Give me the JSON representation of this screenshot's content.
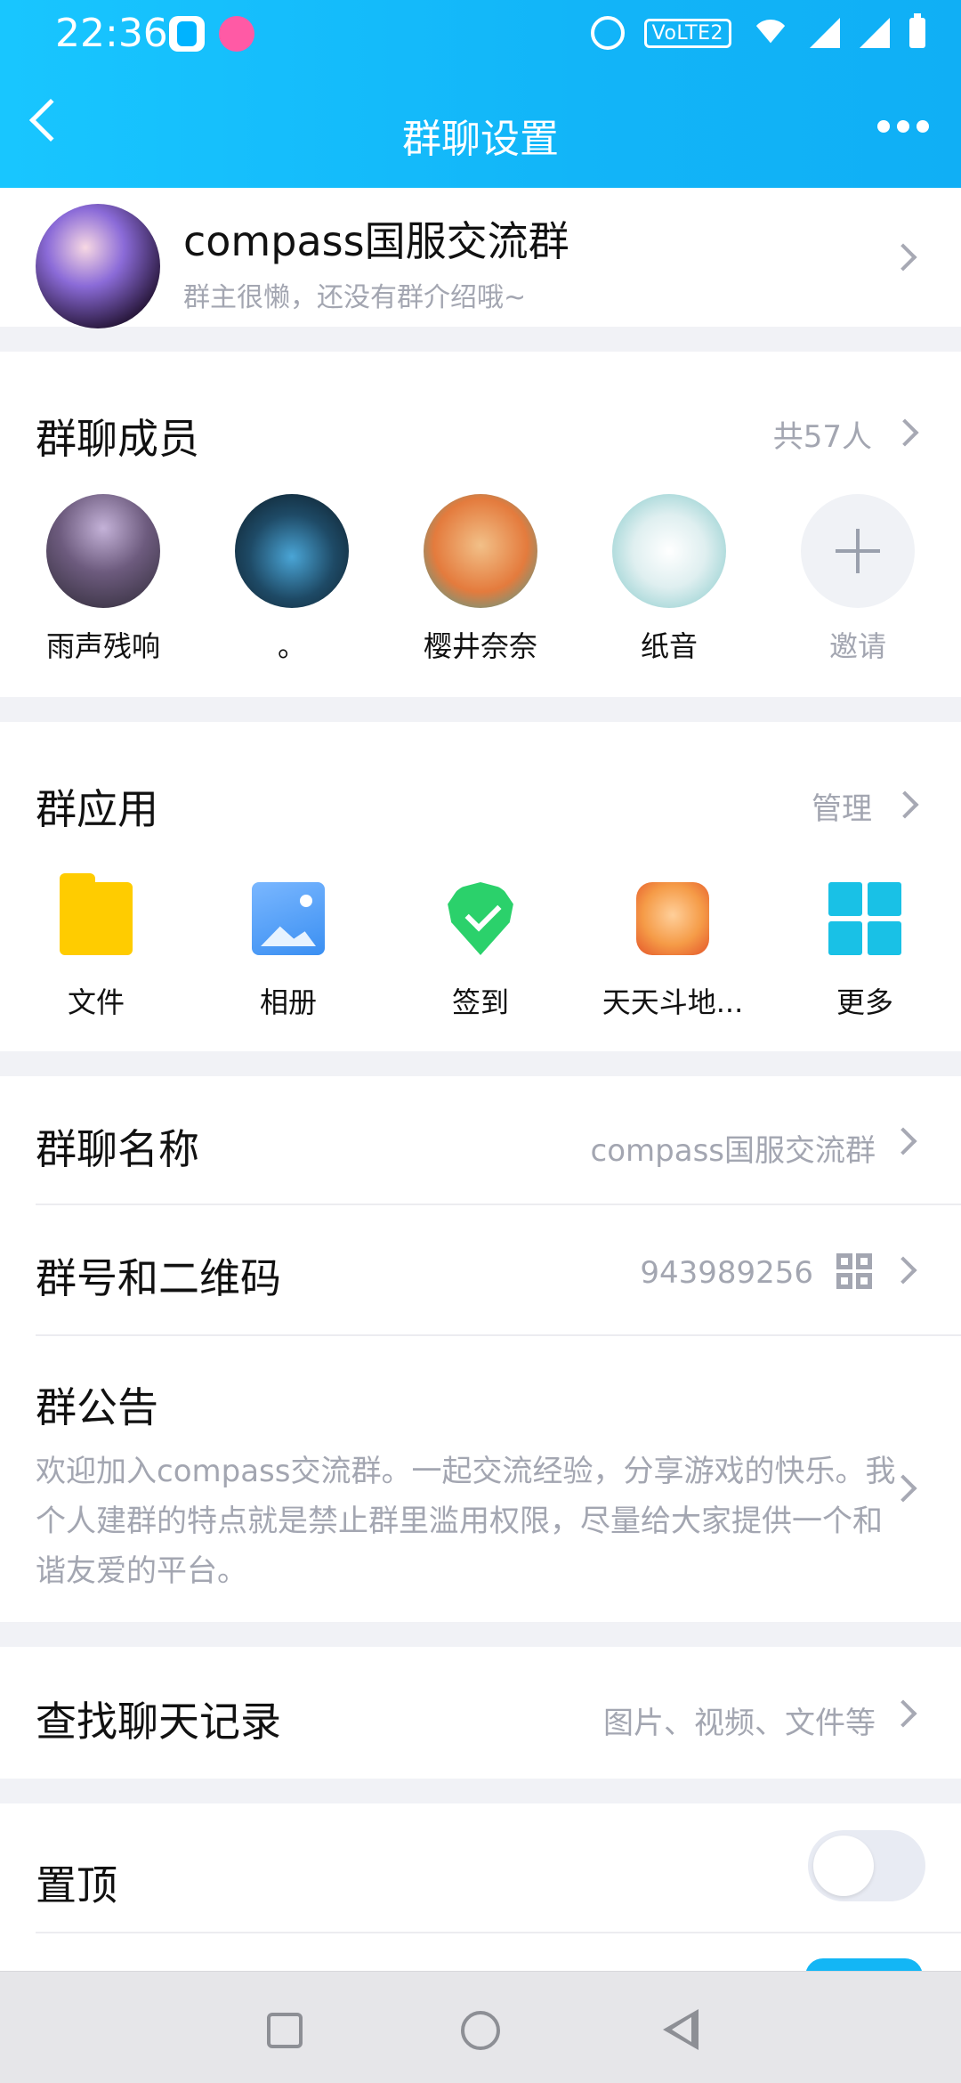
{
  "status_bar": {
    "time": "22:36",
    "volte": "VoLTE2",
    "icons": [
      "alarm-icon",
      "wifi-icon",
      "signal-icon",
      "signal-icon",
      "battery-icon"
    ]
  },
  "header": {
    "title": "群聊设置",
    "back_icon": "chevron-left-icon",
    "more_icon": "more-dots-icon"
  },
  "group": {
    "name": "compass国服交流群",
    "intro": "群主很懒，还没有群介绍哦~"
  },
  "members": {
    "title": "群聊成员",
    "count": "共57人",
    "list": [
      {
        "name": "雨声残响"
      },
      {
        "name": "。"
      },
      {
        "name": "樱井奈奈"
      },
      {
        "name": "纸音"
      }
    ],
    "invite_label": "邀请"
  },
  "apps": {
    "title": "群应用",
    "manage": "管理",
    "items": [
      {
        "label": "文件",
        "icon": "folder-icon"
      },
      {
        "label": "相册",
        "icon": "photo-icon"
      },
      {
        "label": "签到",
        "icon": "checkin-icon"
      },
      {
        "label": "天天斗地...",
        "icon": "game-icon"
      },
      {
        "label": "更多",
        "icon": "grid-icon"
      }
    ]
  },
  "settings": {
    "group_name_label": "群聊名称",
    "group_name_value": "compass国服交流群",
    "group_number_label": "群号和二维码",
    "group_number_value": "943989256",
    "notice_label": "群公告",
    "notice_text": "欢迎加入compass交流群。一起交流经验，分享游戏的快乐。我个人建群的特点就是禁止群里滥用权限，尽量给大家提供一个和谐友爱的平台。",
    "search_label": "查找聊天记录",
    "search_value": "图片、视频、文件等",
    "pin_label": "置顶",
    "pin_on": false
  },
  "colors": {
    "header": "#12b5f8",
    "accent": "#13b6f5",
    "muted_text": "#a3a6b1"
  }
}
